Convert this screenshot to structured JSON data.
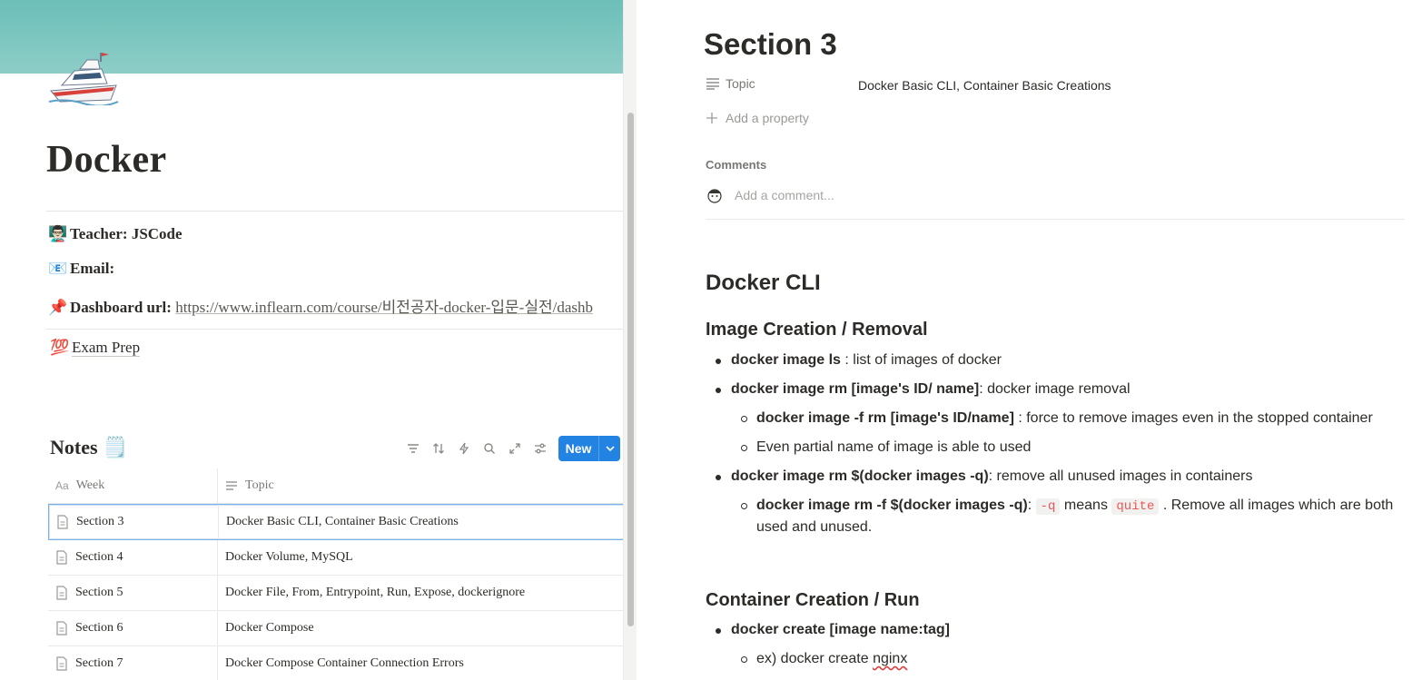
{
  "left": {
    "page_title": "Docker",
    "teacher": {
      "emoji": "👨🏻‍🏫",
      "label": "Teacher:",
      "value": "JSCode"
    },
    "email": {
      "emoji": "📧",
      "label": "Email:",
      "value": ""
    },
    "dashboard": {
      "emoji": "📌",
      "label": "Dashboard url:",
      "value": "https://www.inflearn.com/course/비전공자-docker-입문-실전/dashb"
    },
    "exam": {
      "emoji": "💯",
      "label": "Exam Prep"
    },
    "notes": {
      "title": "Notes",
      "title_emoji": "🗒️",
      "new_label": "New",
      "columns": [
        "Week",
        "Topic"
      ],
      "rows": [
        {
          "week": "Section 3",
          "topic": "Docker Basic CLI, Container Basic Creations"
        },
        {
          "week": "Section 4",
          "topic": "Docker Volume, MySQL"
        },
        {
          "week": "Section 5",
          "topic": "Docker File, From, Entrypoint, Run, Expose, dockerignore"
        },
        {
          "week": "Section 6",
          "topic": "Docker Compose"
        },
        {
          "week": "Section 7",
          "topic": "Docker Compose Container Connection Errors"
        }
      ]
    }
  },
  "right": {
    "title": "Section 3",
    "property_label": "Topic",
    "property_value": "Docker Basic CLI, Container Basic Creations",
    "add_property": "Add a property",
    "comments_label": "Comments",
    "comment_placeholder": "Add a comment...",
    "h_cli": "Docker CLI",
    "h_image": "Image Creation / Removal",
    "items": {
      "i1_b": "docker image ls",
      "i1_t": " : list of images of docker",
      "i2_b": "docker image rm [image's ID/ name]",
      "i2_t": ": docker image removal",
      "i2a_b": "docker image -f rm [image's ID/name]",
      "i2a_t": " : force to remove images even in the stopped container",
      "i2b_t": "Even partial name of image is able to used",
      "i3_b": "docker image rm $(docker images -q)",
      "i3_t": ": remove all unused images in containers",
      "i3a_b": "docker image rm -f $(docker images -q)",
      "i3a_t1": ": ",
      "i3a_code1": "-q",
      "i3a_t2": " means ",
      "i3a_code2": "quite",
      "i3a_t3": " . Remove all images which are both",
      "i3a_t4": "used and unused."
    },
    "h_container": "Container Creation / Run",
    "c1_b": "docker create [image name:tag]",
    "c1a_t1": "ex) docker create ",
    "c1a_t2": "nginx"
  }
}
